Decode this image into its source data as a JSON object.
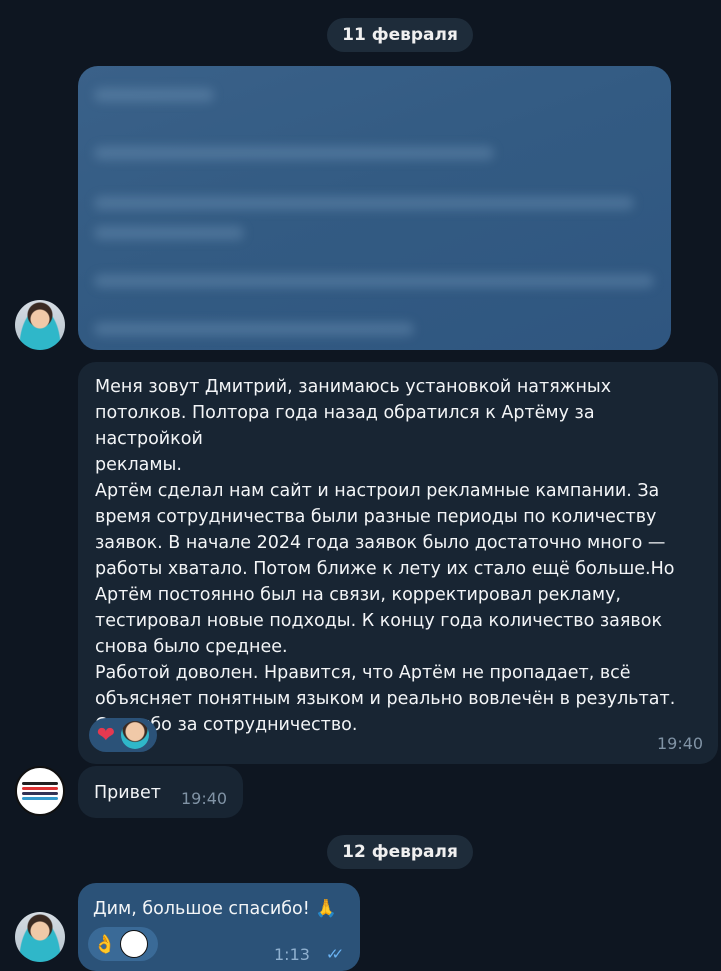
{
  "dates": {
    "first": "11 февраля",
    "second": "12 февраля"
  },
  "messages": {
    "review": {
      "text": "Меня зовут Дмитрий, занимаюсь установкой натяжных\nпотолков. Полтора года назад обратился к Артёму за настройкой\nрекламы.\nАртём сделал нам сайт и настроил рекламные кампании. За\nвремя сотрудничества были разные периоды по количеству\nзаявок. В начале 2024 года заявок было достаточно много —\nработы хватало. Потом ближе к лету их стало ещё больше.Но\nАртём постоянно был на связи, корректировал рекламу,\nтестировал новые подходы. К концу года количество заявок\nснова было среднее.\nРаботой доволен. Нравится, что Артём не пропадает, всё\nобъясняет понятным языком и реально вовлечён в результат.\nСпасибо за сотрудничество.",
      "time": "19:40",
      "reaction_emoji": "❤",
      "reaction_icon": "heart-icon"
    },
    "greeting": {
      "text": "Привет",
      "time": "19:40"
    },
    "thanks": {
      "text": "Дим, большое спасибо! 🙏",
      "time": "1:13",
      "reaction_emoji": "👌",
      "reaction_icon": "ok-hand-icon",
      "status_icon": "double-check-icon"
    }
  },
  "colors": {
    "background": "#0e1621",
    "incoming_bubble": "#182533",
    "outgoing_bubble": "#2b5278",
    "accent": "#6ab3f3"
  }
}
